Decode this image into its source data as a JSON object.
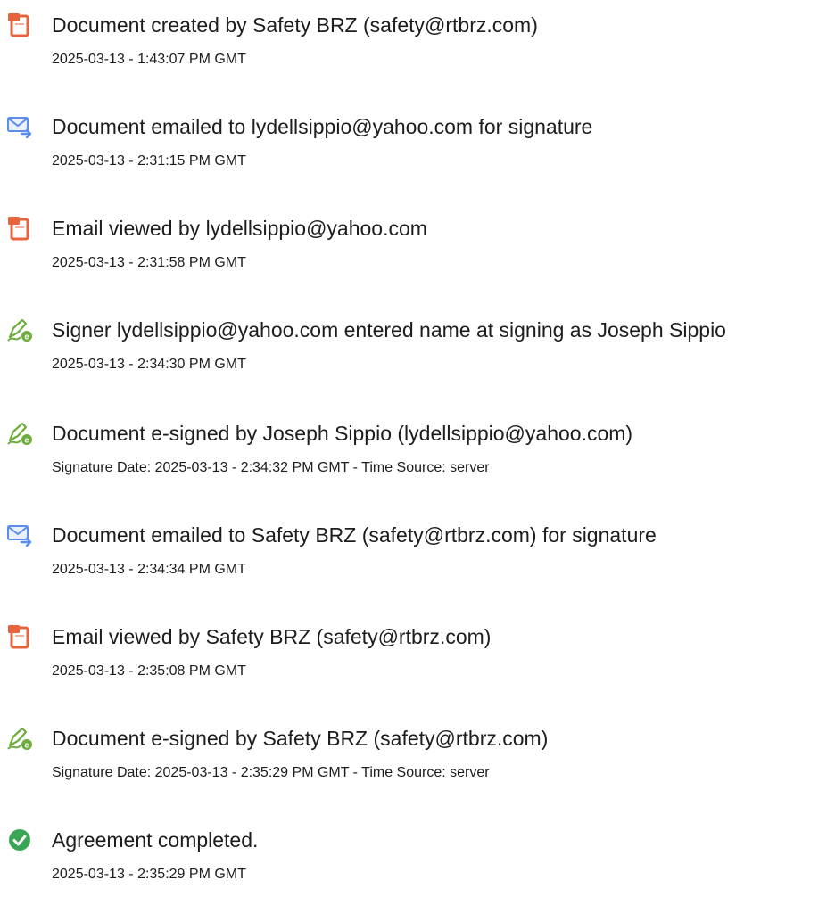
{
  "colors": {
    "document_icon": "#E8643C",
    "email_icon": "#5B8DEF",
    "esign_icon": "#6FAE3E",
    "complete_icon": "#3AA655",
    "text": "#1D1D1D"
  },
  "events": [
    {
      "icon": "document-icon",
      "title": "Document created by Safety BRZ (safety@rtbrz.com)",
      "detail": "2025-03-13 - 1:43:07 PM GMT"
    },
    {
      "icon": "email-sent-icon",
      "title": "Document emailed to lydellsippio@yahoo.com for signature",
      "detail": "2025-03-13 - 2:31:15 PM GMT"
    },
    {
      "icon": "document-icon",
      "title": "Email viewed by lydellsippio@yahoo.com",
      "detail": "2025-03-13 - 2:31:58 PM GMT"
    },
    {
      "icon": "esign-pen-icon",
      "title": "Signer lydellsippio@yahoo.com entered name at signing as Joseph Sippio",
      "detail": "2025-03-13 - 2:34:30 PM GMT"
    },
    {
      "icon": "esign-pen-icon",
      "title": "Document e-signed by Joseph Sippio (lydellsippio@yahoo.com)",
      "detail": "Signature Date: 2025-03-13 - 2:34:32 PM GMT - Time Source: server"
    },
    {
      "icon": "email-sent-icon",
      "title": "Document emailed to Safety BRZ (safety@rtbrz.com) for signature",
      "detail": "2025-03-13 - 2:34:34 PM GMT"
    },
    {
      "icon": "document-icon",
      "title": "Email viewed by Safety BRZ (safety@rtbrz.com)",
      "detail": "2025-03-13 - 2:35:08 PM GMT"
    },
    {
      "icon": "esign-pen-icon",
      "title": "Document e-signed by Safety BRZ (safety@rtbrz.com)",
      "detail": "Signature Date: 2025-03-13 - 2:35:29 PM GMT - Time Source: server"
    },
    {
      "icon": "check-circle-icon",
      "title": "Agreement completed.",
      "detail": "2025-03-13 - 2:35:29 PM GMT"
    }
  ]
}
